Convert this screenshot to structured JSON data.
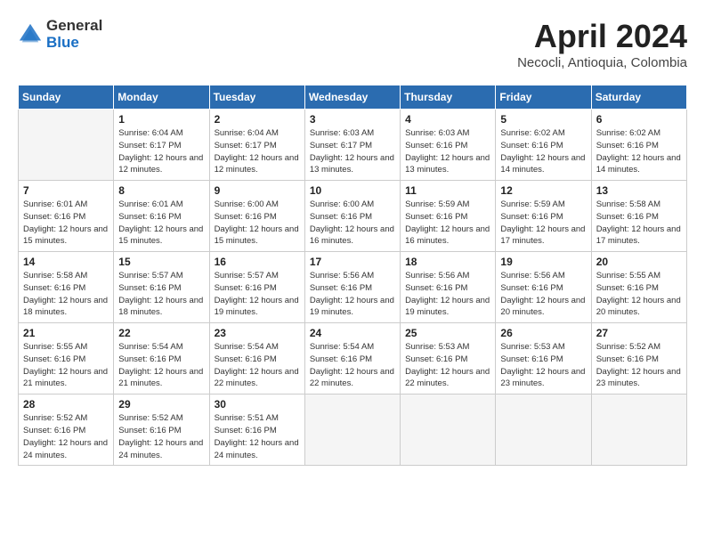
{
  "header": {
    "logo_general": "General",
    "logo_blue": "Blue",
    "title": "April 2024",
    "location": "Necocli, Antioquia, Colombia"
  },
  "weekdays": [
    "Sunday",
    "Monday",
    "Tuesday",
    "Wednesday",
    "Thursday",
    "Friday",
    "Saturday"
  ],
  "weeks": [
    [
      {
        "day": "",
        "empty": true
      },
      {
        "day": "1",
        "sunrise": "6:04 AM",
        "sunset": "6:17 PM",
        "daylight": "12 hours and 12 minutes."
      },
      {
        "day": "2",
        "sunrise": "6:04 AM",
        "sunset": "6:17 PM",
        "daylight": "12 hours and 12 minutes."
      },
      {
        "day": "3",
        "sunrise": "6:03 AM",
        "sunset": "6:17 PM",
        "daylight": "12 hours and 13 minutes."
      },
      {
        "day": "4",
        "sunrise": "6:03 AM",
        "sunset": "6:16 PM",
        "daylight": "12 hours and 13 minutes."
      },
      {
        "day": "5",
        "sunrise": "6:02 AM",
        "sunset": "6:16 PM",
        "daylight": "12 hours and 14 minutes."
      },
      {
        "day": "6",
        "sunrise": "6:02 AM",
        "sunset": "6:16 PM",
        "daylight": "12 hours and 14 minutes."
      }
    ],
    [
      {
        "day": "7",
        "sunrise": "6:01 AM",
        "sunset": "6:16 PM",
        "daylight": "12 hours and 15 minutes."
      },
      {
        "day": "8",
        "sunrise": "6:01 AM",
        "sunset": "6:16 PM",
        "daylight": "12 hours and 15 minutes."
      },
      {
        "day": "9",
        "sunrise": "6:00 AM",
        "sunset": "6:16 PM",
        "daylight": "12 hours and 15 minutes."
      },
      {
        "day": "10",
        "sunrise": "6:00 AM",
        "sunset": "6:16 PM",
        "daylight": "12 hours and 16 minutes."
      },
      {
        "day": "11",
        "sunrise": "5:59 AM",
        "sunset": "6:16 PM",
        "daylight": "12 hours and 16 minutes."
      },
      {
        "day": "12",
        "sunrise": "5:59 AM",
        "sunset": "6:16 PM",
        "daylight": "12 hours and 17 minutes."
      },
      {
        "day": "13",
        "sunrise": "5:58 AM",
        "sunset": "6:16 PM",
        "daylight": "12 hours and 17 minutes."
      }
    ],
    [
      {
        "day": "14",
        "sunrise": "5:58 AM",
        "sunset": "6:16 PM",
        "daylight": "12 hours and 18 minutes."
      },
      {
        "day": "15",
        "sunrise": "5:57 AM",
        "sunset": "6:16 PM",
        "daylight": "12 hours and 18 minutes."
      },
      {
        "day": "16",
        "sunrise": "5:57 AM",
        "sunset": "6:16 PM",
        "daylight": "12 hours and 19 minutes."
      },
      {
        "day": "17",
        "sunrise": "5:56 AM",
        "sunset": "6:16 PM",
        "daylight": "12 hours and 19 minutes."
      },
      {
        "day": "18",
        "sunrise": "5:56 AM",
        "sunset": "6:16 PM",
        "daylight": "12 hours and 19 minutes."
      },
      {
        "day": "19",
        "sunrise": "5:56 AM",
        "sunset": "6:16 PM",
        "daylight": "12 hours and 20 minutes."
      },
      {
        "day": "20",
        "sunrise": "5:55 AM",
        "sunset": "6:16 PM",
        "daylight": "12 hours and 20 minutes."
      }
    ],
    [
      {
        "day": "21",
        "sunrise": "5:55 AM",
        "sunset": "6:16 PM",
        "daylight": "12 hours and 21 minutes."
      },
      {
        "day": "22",
        "sunrise": "5:54 AM",
        "sunset": "6:16 PM",
        "daylight": "12 hours and 21 minutes."
      },
      {
        "day": "23",
        "sunrise": "5:54 AM",
        "sunset": "6:16 PM",
        "daylight": "12 hours and 22 minutes."
      },
      {
        "day": "24",
        "sunrise": "5:54 AM",
        "sunset": "6:16 PM",
        "daylight": "12 hours and 22 minutes."
      },
      {
        "day": "25",
        "sunrise": "5:53 AM",
        "sunset": "6:16 PM",
        "daylight": "12 hours and 22 minutes."
      },
      {
        "day": "26",
        "sunrise": "5:53 AM",
        "sunset": "6:16 PM",
        "daylight": "12 hours and 23 minutes."
      },
      {
        "day": "27",
        "sunrise": "5:52 AM",
        "sunset": "6:16 PM",
        "daylight": "12 hours and 23 minutes."
      }
    ],
    [
      {
        "day": "28",
        "sunrise": "5:52 AM",
        "sunset": "6:16 PM",
        "daylight": "12 hours and 24 minutes."
      },
      {
        "day": "29",
        "sunrise": "5:52 AM",
        "sunset": "6:16 PM",
        "daylight": "12 hours and 24 minutes."
      },
      {
        "day": "30",
        "sunrise": "5:51 AM",
        "sunset": "6:16 PM",
        "daylight": "12 hours and 24 minutes."
      },
      {
        "day": "",
        "empty": true
      },
      {
        "day": "",
        "empty": true
      },
      {
        "day": "",
        "empty": true
      },
      {
        "day": "",
        "empty": true
      }
    ]
  ]
}
